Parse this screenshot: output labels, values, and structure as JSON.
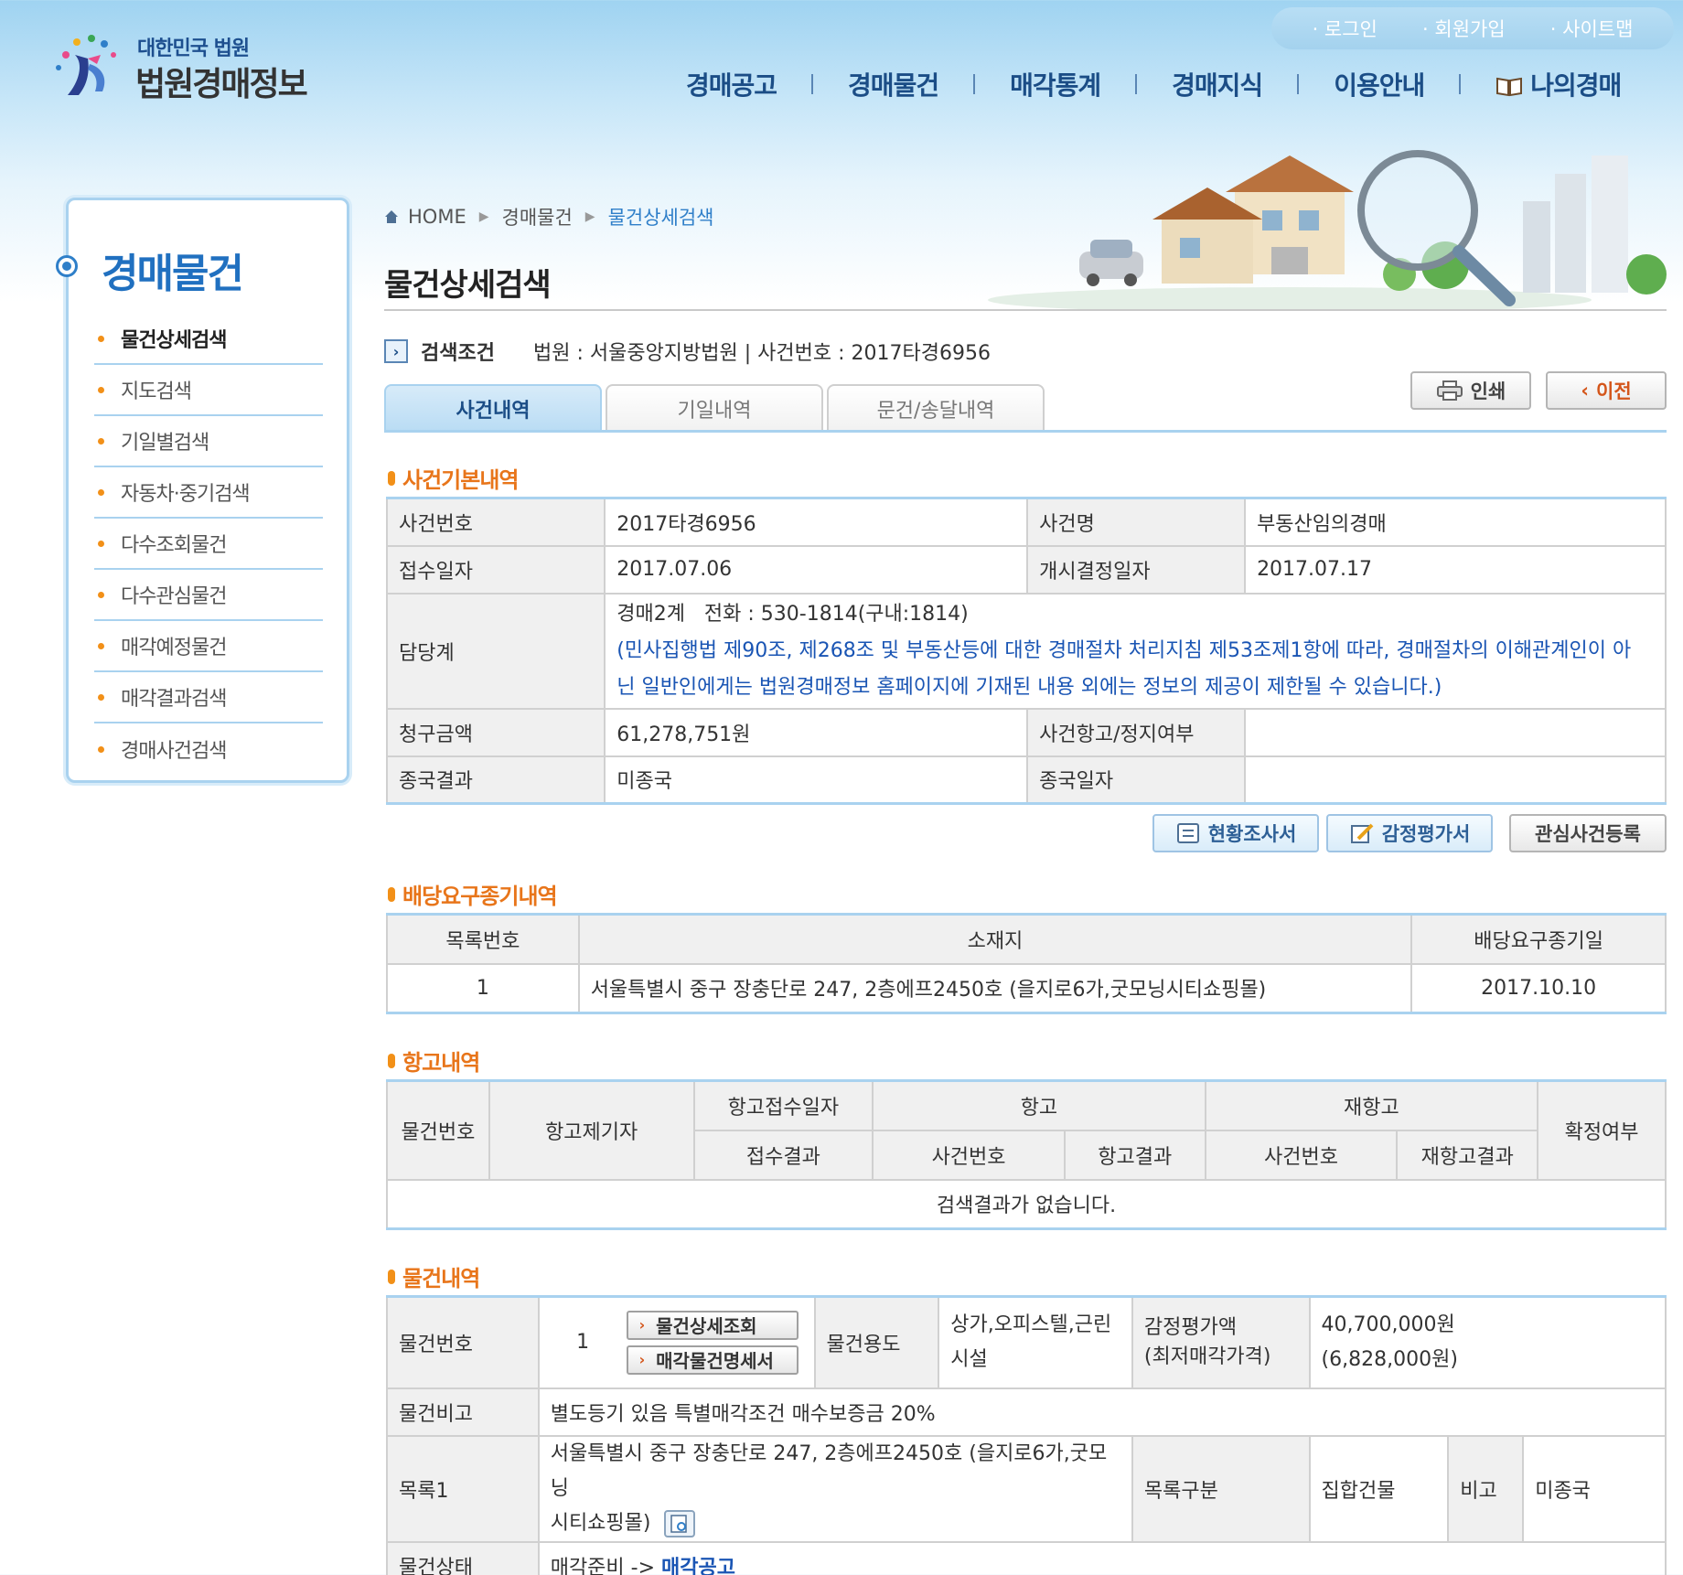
{
  "header": {
    "logo_sub": "대한민국 법원",
    "logo_main": "법원경매정보",
    "util_links": [
      "로그인",
      "회원가입",
      "사이트맵"
    ],
    "gnb": [
      "경매공고",
      "경매물건",
      "매각통계",
      "경매지식",
      "이용안내",
      "나의경매"
    ]
  },
  "sidebar": {
    "title": "경매물건",
    "items": [
      "물건상세검색",
      "지도검색",
      "기일별검색",
      "자동차·중기검색",
      "다수조회물건",
      "다수관심물건",
      "매각예정물건",
      "매각결과검색",
      "경매사건검색"
    ],
    "active_index": 0
  },
  "breadcrumb": [
    "HOME",
    "경매물건",
    "물건상세검색"
  ],
  "page_title": "물건상세검색",
  "search_condition": {
    "label": "검색조건",
    "value": "법원 : 서울중앙지방법원 | 사건번호 : 2017타경6956"
  },
  "tabs": [
    "사건내역",
    "기일내역",
    "문건/송달내역"
  ],
  "buttons": {
    "print": "인쇄",
    "back": "이전",
    "status_report": "현황조사서",
    "appraisal": "감정평가서",
    "interest": "관심사건등록"
  },
  "case_basic": {
    "title": "사건기본내역",
    "case_no_label": "사건번호",
    "case_no": "2017타경6956",
    "case_name_label": "사건명",
    "case_name": "부동산임의경매",
    "received_label": "접수일자",
    "received": "2017.07.06",
    "start_label": "개시결정일자",
    "start": "2017.07.17",
    "dept_label": "담당계",
    "dept": "경매2계   전화 : 530-1814(구내:1814)",
    "notice_line1": "(민사집행법 제90조, 제268조 및 부동산등에 대한 경매절차 처리지침 제53조제1항에 따라, 경매절차의 이해관계인이 아",
    "notice_line2": "닌 일반인에게는 법원경매정보 홈페이지에 기재된 내용 외에는 정보의 제공이 제한될 수 있습니다.)",
    "claim_label": "청구금액",
    "claim": "61,278,751원",
    "appeal_label": "사건항고/정지여부",
    "appeal": "",
    "result_label": "종국결과",
    "result": "미종국",
    "end_date_label": "종국일자",
    "end_date": ""
  },
  "dividend": {
    "title": "배당요구종기내역",
    "headers": [
      "목록번호",
      "소재지",
      "배당요구종기일"
    ],
    "rows": [
      [
        "1",
        "서울특별시 중구 장충단로 247, 2층에프2450호 (을지로6가,굿모닝시티쇼핑몰)",
        "2017.10.10"
      ]
    ]
  },
  "appeal_history": {
    "title": "항고내역",
    "h_item": "물건번호",
    "h_filer": "항고제기자",
    "h_recv_date": "항고접수일자",
    "h_recv_result": "접수결과",
    "h_appeal": "항고",
    "h_appeal_no": "사건번호",
    "h_appeal_result": "항고결과",
    "h_reappeal": "재항고",
    "h_reappeal_no": "사건번호",
    "h_reappeal_result": "재항고결과",
    "h_final": "확정여부",
    "empty": "검색결과가 없습니다."
  },
  "item_detail": {
    "title": "물건내역",
    "item_no_label": "물건번호",
    "item_no": "1",
    "btn_detail": "물건상세조회",
    "btn_statement": "매각물건명세서",
    "use_label": "물건용도",
    "use_line1": "상가,오피스텔,근린",
    "use_line2": "시설",
    "appraisal_label_1": "감정평가액",
    "appraisal_label_2": "(최저매각가격)",
    "appraisal_value": "40,700,000원",
    "min_price": "(6,828,000원)",
    "remark_label": "물건비고",
    "remark": "별도등기 있음 특별매각조건 매수보증금 20%",
    "list_label": "목록1",
    "list_addr_1": "서울특별시 중구 장충단로 247, 2층에프2450호 (을지로6가,굿모닝",
    "list_addr_2": "시티쇼핑몰)",
    "list_type_label": "목록구분",
    "list_type": "집합건물",
    "list_note_label": "비고",
    "list_note": "미종국",
    "status_label": "물건상태",
    "status_prefix": "매각준비 -> ",
    "status_link": "매각공고"
  }
}
